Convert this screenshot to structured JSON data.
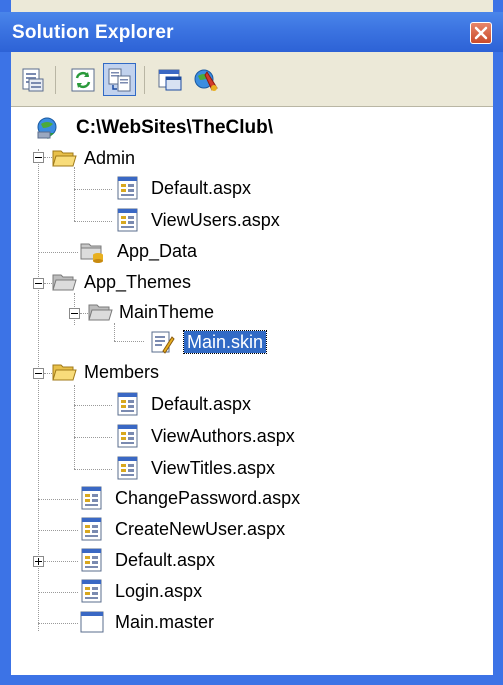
{
  "window": {
    "title": "Solution Explorer"
  },
  "toolbar": {
    "buttons": [
      {
        "name": "properties-icon"
      },
      {
        "name": "refresh-icon"
      },
      {
        "name": "nest-related-files-icon"
      },
      {
        "name": "view-designer-icon"
      },
      {
        "name": "asp-net-configuration-icon"
      }
    ]
  },
  "tree": {
    "root": "C:\\WebSites\\TheClub\\",
    "admin": "Admin",
    "admin_default": "Default.aspx",
    "admin_viewusers": "ViewUsers.aspx",
    "app_data": "App_Data",
    "app_themes": "App_Themes",
    "maintheme": "MainTheme",
    "main_skin": "Main.skin",
    "members": "Members",
    "members_default": "Default.aspx",
    "members_viewauthors": "ViewAuthors.aspx",
    "members_viewtitles": "ViewTitles.aspx",
    "changepassword": "ChangePassword.aspx",
    "createnewuser": "CreateNewUser.aspx",
    "default": "Default.aspx",
    "login": "Login.aspx",
    "main_master": "Main.master"
  },
  "colors": {
    "accent": "#316ac5",
    "titlebar": "#3a72e0",
    "close": "#c94a2a"
  }
}
